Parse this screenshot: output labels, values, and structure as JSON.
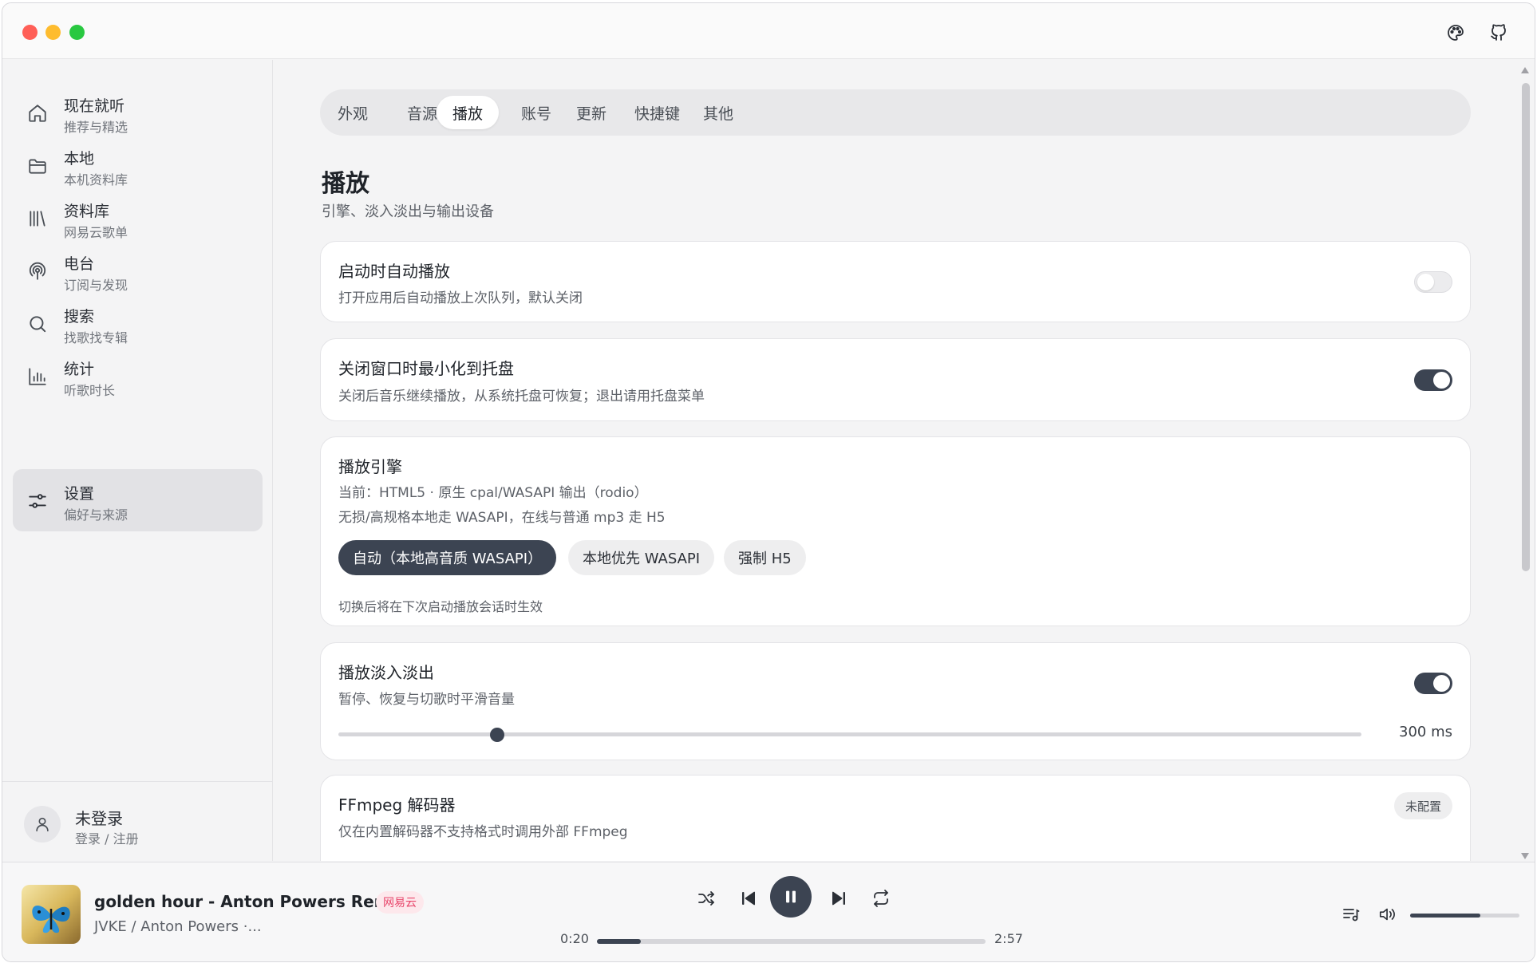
{
  "sidebar": {
    "items": [
      {
        "title": "现在就听",
        "subtitle": "推荐与精选",
        "icon": "home-icon"
      },
      {
        "title": "本地",
        "subtitle": "本机资料库",
        "icon": "folder-icon"
      },
      {
        "title": "资料库",
        "subtitle": "网易云歌单",
        "icon": "library-icon"
      },
      {
        "title": "电台",
        "subtitle": "订阅与发现",
        "icon": "podcast-icon"
      },
      {
        "title": "搜索",
        "subtitle": "找歌找专辑",
        "icon": "search-icon"
      },
      {
        "title": "统计",
        "subtitle": "听歌时长",
        "icon": "stats-icon"
      },
      {
        "title": "设置",
        "subtitle": "偏好与来源",
        "icon": "settings-icon",
        "active": true
      }
    ],
    "user": {
      "name": "未登录",
      "action": "登录 / 注册"
    }
  },
  "tabs": [
    {
      "label": "外观"
    },
    {
      "label": "音源"
    },
    {
      "label": "播放",
      "active": true
    },
    {
      "label": "账号"
    },
    {
      "label": "更新"
    },
    {
      "label": "快捷键"
    },
    {
      "label": "其他"
    }
  ],
  "page": {
    "title": "播放",
    "subtitle": "引擎、淡入淡出与输出设备"
  },
  "settings": {
    "autoplay": {
      "title": "启动时自动播放",
      "desc": "打开应用后自动播放上次队列，默认关闭",
      "enabled": false
    },
    "tray": {
      "title": "关闭窗口时最小化到托盘",
      "desc": "关闭后音乐继续播放，从系统托盘可恢复；退出请用托盘菜单",
      "enabled": true
    },
    "engine": {
      "title": "播放引擎",
      "current": "当前：HTML5 · 原生 cpal/WASAPI 输出（rodio）",
      "desc": "无损/高规格本地走 WASAPI，在线与普通 mp3 走 H5",
      "options": [
        "自动（本地高音质 WASAPI）",
        "本地优先 WASAPI",
        "强制 H5"
      ],
      "selected": 0,
      "note": "切换后将在下次启动播放会话时生效"
    },
    "fade": {
      "title": "播放淡入淡出",
      "desc": "暂停、恢复与切歌时平滑音量",
      "enabled": true,
      "value_label": "300 ms",
      "fraction": 0.155
    },
    "ffmpeg": {
      "title": "FFmpeg 解码器",
      "desc": "仅在内置解码器不支持格式时调用外部 FFmpeg",
      "badge": "未配置"
    }
  },
  "player": {
    "title": "golden hour - Anton Powers Remix",
    "source": "网易云",
    "artist": "JVKE / Anton Powers ·...",
    "elapsed": "0:20",
    "duration": "2:57",
    "progress_fraction": 0.113,
    "volume_fraction": 0.64
  },
  "colors": {
    "accent": "#3c4452",
    "source_badge": "#e8466b"
  }
}
